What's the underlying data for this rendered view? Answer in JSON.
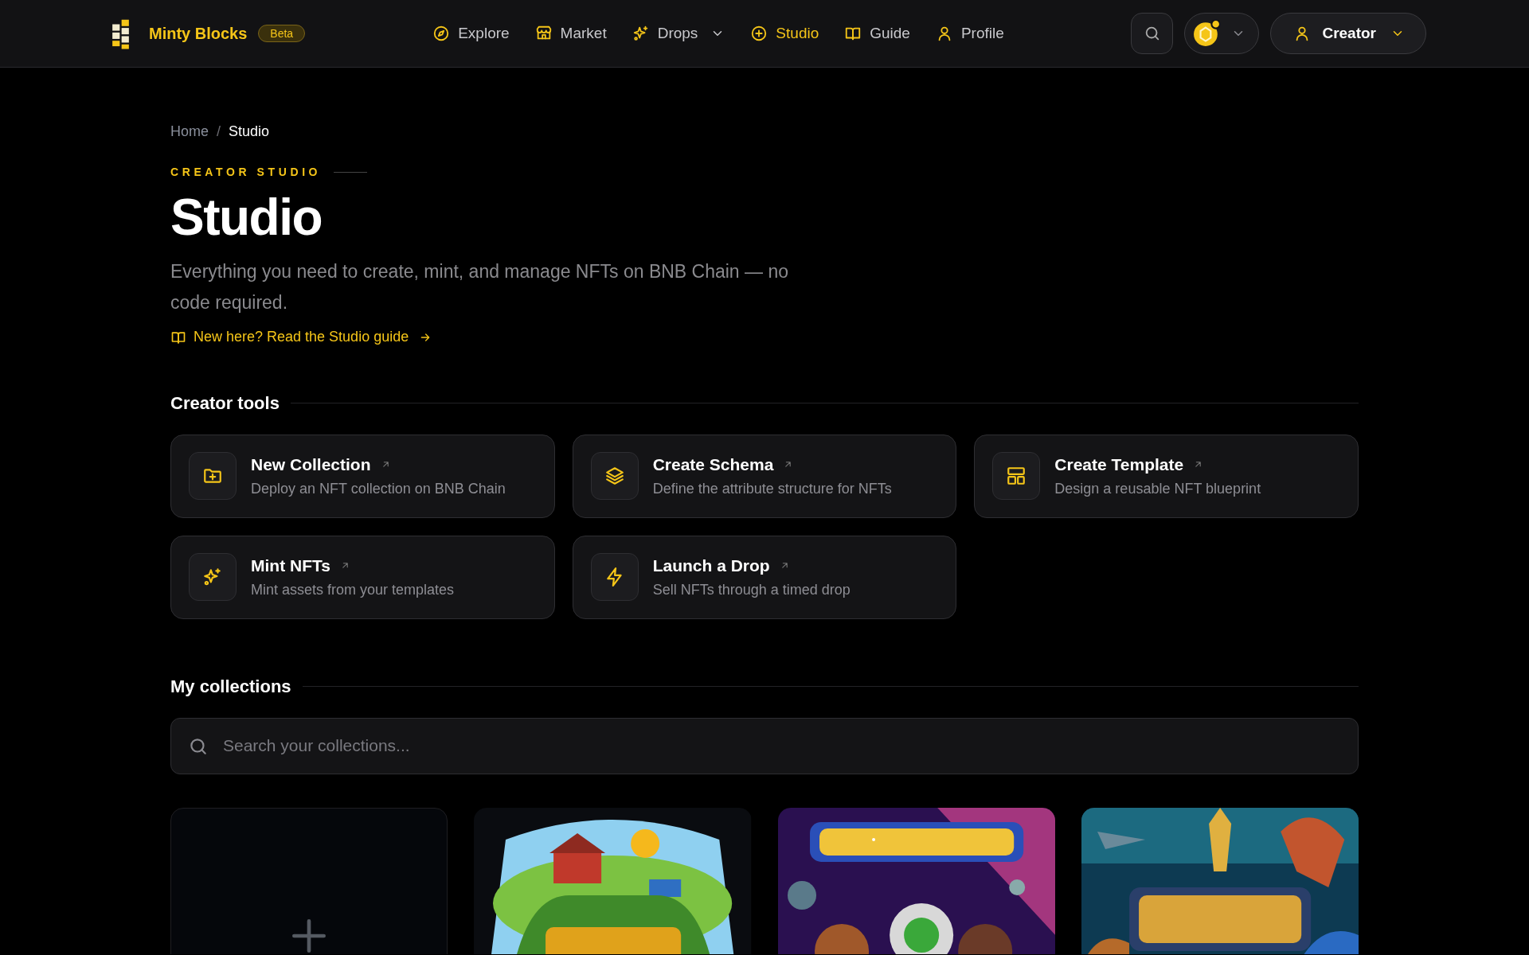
{
  "brand": {
    "name": "Minty Blocks",
    "badge": "Beta"
  },
  "nav": [
    {
      "label": "Explore",
      "selected": false,
      "has_menu": false
    },
    {
      "label": "Market",
      "selected": false,
      "has_menu": false
    },
    {
      "label": "Drops",
      "selected": false,
      "has_menu": true
    },
    {
      "label": "Studio",
      "selected": true,
      "has_menu": false
    },
    {
      "label": "Guide",
      "selected": false,
      "has_menu": false
    },
    {
      "label": "Profile",
      "selected": false,
      "has_menu": false
    }
  ],
  "account": {
    "label": "Creator"
  },
  "breadcrumb": {
    "separator": "/",
    "items": [
      {
        "label": "Home",
        "current": false
      },
      {
        "label": "Studio",
        "current": true
      }
    ]
  },
  "eyebrow": "CREATOR STUDIO",
  "title": "Studio",
  "description": "Everything you need to create, mint, and manage NFTs on BNB Chain — no code required.",
  "guide_link": "New here? Read the Studio guide",
  "tools_heading": "Creator tools",
  "tools": [
    {
      "title": "New Collection",
      "text": "Deploy an NFT collection on BNB Chain"
    },
    {
      "title": "Create Schema",
      "text": "Define the attribute structure for NFTs"
    },
    {
      "title": "Create Template",
      "text": "Design a reusable NFT blueprint"
    },
    {
      "title": "Mint NFTs",
      "text": "Mint assets from your templates"
    },
    {
      "title": "Launch a Drop",
      "text": "Sell NFTs through a timed drop"
    }
  ],
  "collections_heading": "My collections",
  "search": {
    "placeholder": "Search your collections..."
  },
  "collections": [
    {
      "kind": "new"
    },
    {
      "kind": "picture"
    },
    {
      "kind": "picture"
    },
    {
      "kind": "picture"
    }
  ]
}
